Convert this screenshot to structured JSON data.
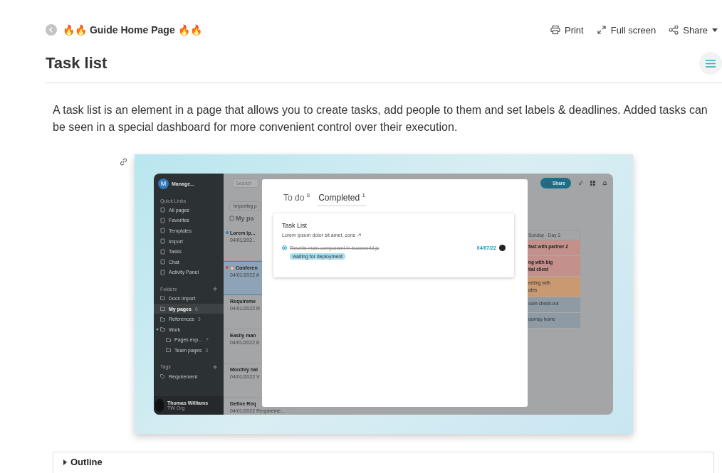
{
  "header": {
    "breadcrumb": "🔥🔥 Guide Home Page 🔥🔥",
    "actions": [
      {
        "kind": "print",
        "label": "Print"
      },
      {
        "kind": "fullscreen",
        "label": "Full screen"
      },
      {
        "kind": "share",
        "label": "Share"
      }
    ]
  },
  "title": "Task list",
  "intro": "A task list is an element in a page that allows you to create tasks, add people to them and set labels & deadlines. Added tasks can be seen in a special dashboard for more convenient control over their execution.",
  "screenshot": {
    "workspace": {
      "initial": "M",
      "name": "Manage..."
    },
    "quick_links_label": "Quick Links",
    "quick_links": [
      {
        "label": "All pages"
      },
      {
        "label": "Favorites"
      },
      {
        "label": "Templates"
      },
      {
        "label": "Import"
      },
      {
        "label": "Tasks"
      },
      {
        "label": "Chat"
      },
      {
        "label": "Activity Panel"
      }
    ],
    "folders_label": "Folders",
    "folders": [
      {
        "label": "Docs import",
        "selected": false
      },
      {
        "label": "My pages",
        "count": "6",
        "selected": true
      },
      {
        "label": "References",
        "count": "3",
        "selected": false
      },
      {
        "label": "Work",
        "selected": false,
        "expanded": true,
        "children": [
          {
            "label": "Pages exp...",
            "count": "7",
            "selected": false
          },
          {
            "label": "Team pages",
            "count": "3",
            "selected": false
          }
        ]
      }
    ],
    "tags_label": "Tags",
    "tags": [
      "Requirement"
    ],
    "user": {
      "name": "Thomas Williams",
      "org": "TW Org"
    },
    "search": {
      "placeholder": "Search"
    },
    "share_button": "Share",
    "filter_chip": "Importing p",
    "list_heading": "My pa",
    "pages": [
      {
        "kind": "page",
        "title": "Lorem ip...",
        "meta": "04/01/202..",
        "color": "#2f7fc0",
        "selected": false
      },
      {
        "kind": "event",
        "title": "Conferen",
        "meta": "04/01/2022 A",
        "color": "#c94a4a",
        "selected": true
      },
      {
        "kind": "page",
        "title": "Requireme",
        "meta": "04/01/2022 R",
        "selected": false
      },
      {
        "kind": "page",
        "title": "Easily man",
        "meta": "04/01/2022 E",
        "selected": false
      },
      {
        "kind": "page",
        "title": "Monthly hal",
        "meta": "04/01/2022 V",
        "selected": false
      },
      {
        "kind": "page",
        "title": "Define Req",
        "meta": "04/01/2022 Requireme...",
        "selected": false
      }
    ],
    "calendar": {
      "header": "Sunday - Day 3",
      "events": [
        {
          "text": "fast with partner Z",
          "color": "#c4908c",
          "bold": true
        },
        {
          "text": "ng with big\ntial client",
          "color": "#c4908c",
          "bold": true
        },
        {
          "text": "eeting with\nates",
          "color": "#c99a72",
          "bold": false
        },
        {
          "text": "oom check-out",
          "color": "#8e9aa4",
          "bold": false
        },
        {
          "text": "ourney home",
          "color": "#8e9aa4",
          "bold": false
        }
      ]
    },
    "modal": {
      "tabs": [
        {
          "label": "To do",
          "count": "8",
          "selected": false
        },
        {
          "label": "Completed",
          "count": "1",
          "selected": true
        }
      ],
      "card": {
        "title": "Task List",
        "description": "Lorem ipsum dolor sit amet, cons",
        "tasks": [
          {
            "text": "Rewrite main component in buzzworld.js",
            "done": true,
            "date": "04/07/22",
            "labels": [
              "waiting for deployment"
            ]
          }
        ]
      }
    }
  },
  "outline": {
    "label": "Outline",
    "expanded": false
  }
}
